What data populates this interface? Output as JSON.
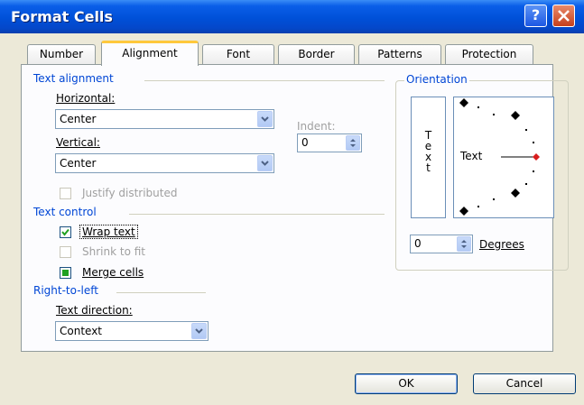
{
  "window": {
    "title": "Format Cells",
    "help_glyph": "?"
  },
  "tabs": [
    "Number",
    "Alignment",
    "Font",
    "Border",
    "Patterns",
    "Protection"
  ],
  "text_alignment": {
    "section_label": "Text alignment",
    "horizontal_label": "Horizontal:",
    "horizontal_value": "Center",
    "vertical_label": "Vertical:",
    "vertical_value": "Center",
    "indent_label": "Indent:",
    "indent_value": "0",
    "justify_distributed_label": "Justify distributed"
  },
  "text_control": {
    "section_label": "Text control",
    "wrap_text_label": "Wrap text",
    "wrap_text_checked": true,
    "shrink_to_fit_label": "Shrink to fit",
    "shrink_to_fit_checked": false,
    "merge_cells_label": "Merge cells",
    "merge_cells_state": "mixed"
  },
  "right_to_left": {
    "section_label": "Right-to-left",
    "text_direction_label": "Text direction:",
    "text_direction_value": "Context"
  },
  "orientation": {
    "section_label": "Orientation",
    "vertical_text_letters": [
      "T",
      "e",
      "x",
      "t"
    ],
    "dial_text": "Text",
    "degrees_value": "0",
    "degrees_label": "Degrees",
    "accent_color": "#d81e1e"
  },
  "buttons": {
    "ok_label": "OK",
    "cancel_label": "Cancel"
  }
}
